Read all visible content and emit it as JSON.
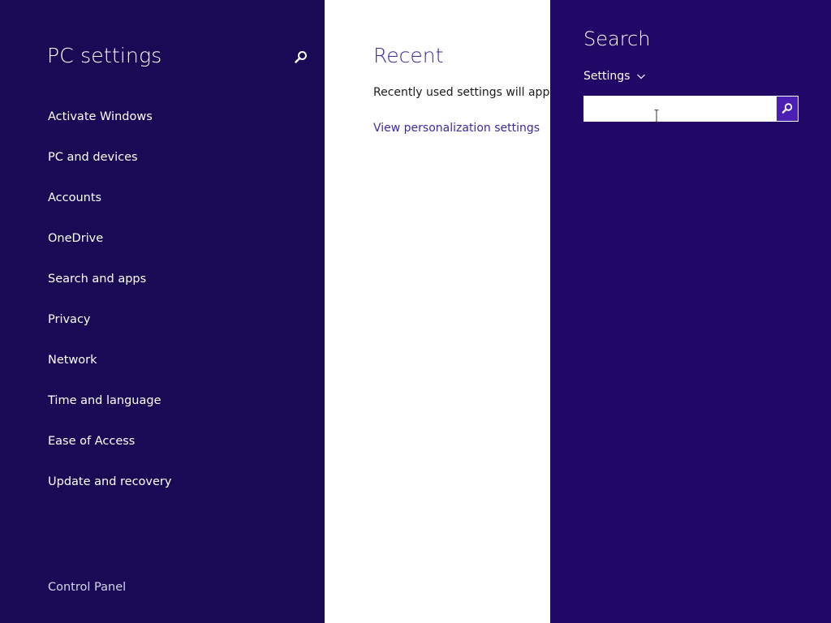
{
  "nav": {
    "title": "PC settings",
    "search_icon": "magnifier-icon",
    "items": [
      {
        "label": "Activate Windows"
      },
      {
        "label": "PC and devices"
      },
      {
        "label": "Accounts"
      },
      {
        "label": "OneDrive"
      },
      {
        "label": "Search and apps"
      },
      {
        "label": "Privacy"
      },
      {
        "label": "Network"
      },
      {
        "label": "Time and language"
      },
      {
        "label": "Ease of Access"
      },
      {
        "label": "Update and recovery"
      }
    ],
    "control_panel": "Control Panel"
  },
  "content": {
    "title": "Recent",
    "text": "Recently used settings will appear here.",
    "link": "View personalization settings"
  },
  "charm": {
    "title": "Search",
    "scope": "Settings",
    "scope_icon": "chevron-down-icon",
    "input_value": "",
    "submit_icon": "magnifier-icon"
  },
  "colors": {
    "nav_bg": "#180a55",
    "charm_bg": "#210866",
    "accent": "#4b1fb4",
    "link": "#3a2aa3"
  }
}
